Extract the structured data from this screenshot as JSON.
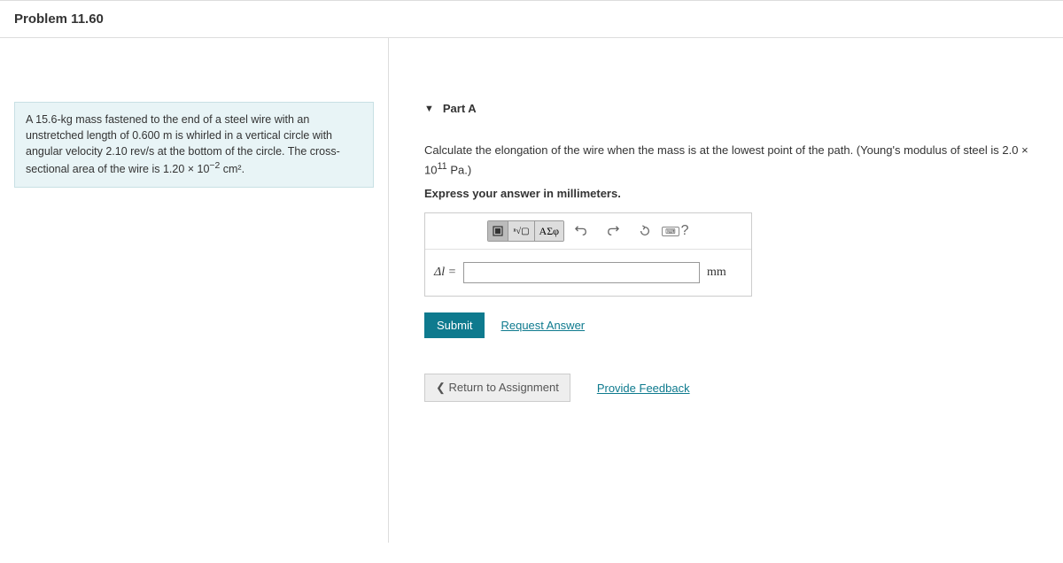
{
  "header": {
    "title": "Problem 11.60"
  },
  "problem": {
    "text_before": "A 15.6-kg mass fastened to the end of a steel wire with an unstretched length of 0.600 m is whirled in a vertical circle with angular velocity 2.10 rev/s at the bottom of the circle. The cross-sectional area of the wire is 1.20 × 10",
    "exp": "−2",
    "text_after": " cm²."
  },
  "part": {
    "title": "Part A",
    "instruction_before": "Calculate the elongation of the wire when the mass is at the lowest point of the path. (Young's modulus of steel is 2.0 × 10",
    "instruction_exp": "11",
    "instruction_after": " Pa.)",
    "sub_instruction": "Express your answer in millimeters.",
    "variable": "Δl =",
    "unit": "mm",
    "toolbar": {
      "templates": "▢",
      "math": "ⁿ√▢",
      "greek": "ΑΣφ",
      "help": "?"
    },
    "submit": "Submit",
    "request_answer": "Request Answer"
  },
  "footer": {
    "return": "Return to Assignment",
    "feedback": "Provide Feedback"
  }
}
